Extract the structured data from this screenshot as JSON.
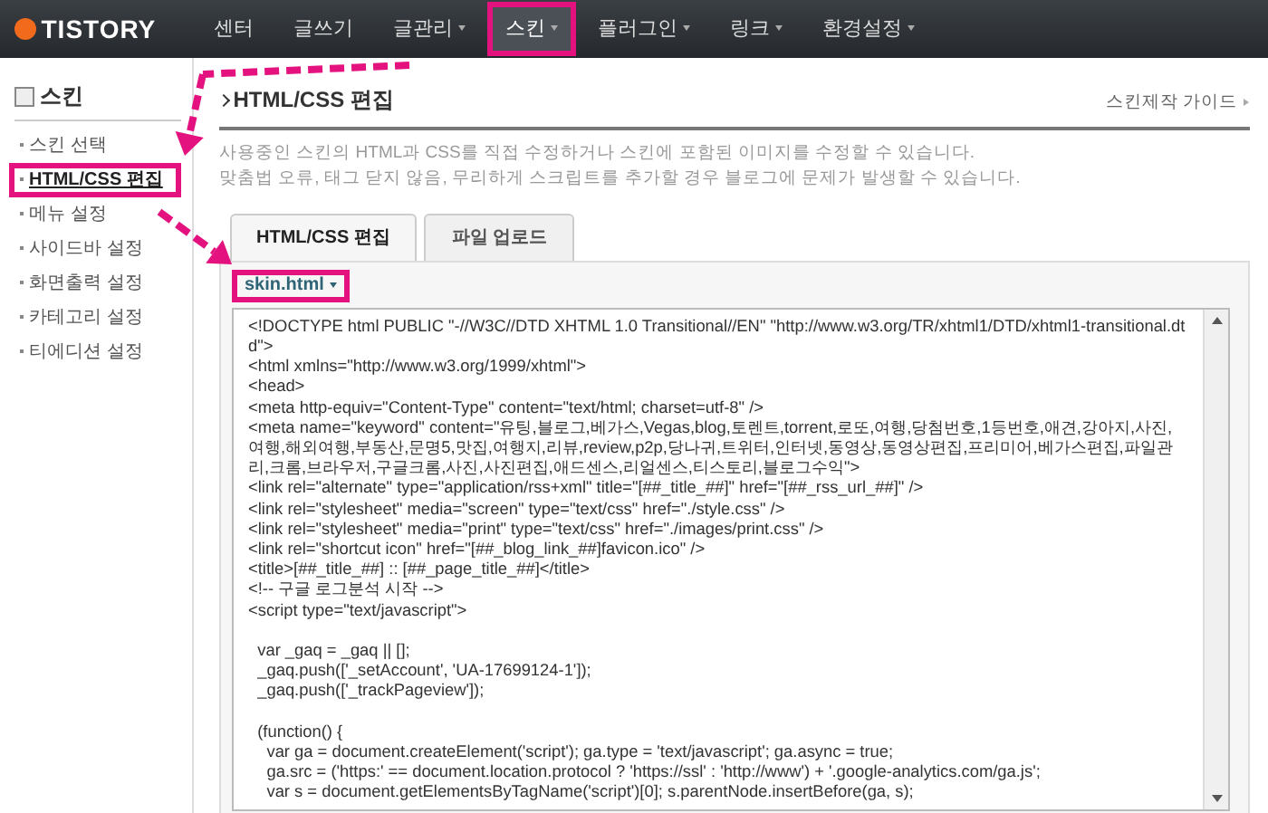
{
  "brand": {
    "name": "TISTORY"
  },
  "nav": [
    {
      "label": "센터",
      "has_menu": false,
      "selected": false,
      "highlighted": false
    },
    {
      "label": "글쓰기",
      "has_menu": false,
      "selected": false,
      "highlighted": false
    },
    {
      "label": "글관리",
      "has_menu": true,
      "selected": false,
      "highlighted": false
    },
    {
      "label": "스킨",
      "has_menu": true,
      "selected": true,
      "highlighted": true
    },
    {
      "label": "플러그인",
      "has_menu": true,
      "selected": false,
      "highlighted": false
    },
    {
      "label": "링크",
      "has_menu": true,
      "selected": false,
      "highlighted": false
    },
    {
      "label": "환경설정",
      "has_menu": true,
      "selected": false,
      "highlighted": false
    }
  ],
  "sidebar": {
    "title": "스킨",
    "items": [
      {
        "label": "스킨 선택",
        "selected": false,
        "highlighted": false
      },
      {
        "label": "HTML/CSS 편집",
        "selected": true,
        "highlighted": true
      },
      {
        "label": "메뉴 설정",
        "selected": false,
        "highlighted": false
      },
      {
        "label": "사이드바 설정",
        "selected": false,
        "highlighted": false
      },
      {
        "label": "화면출력 설정",
        "selected": false,
        "highlighted": false
      },
      {
        "label": "카테고리 설정",
        "selected": false,
        "highlighted": false
      },
      {
        "label": "티에디션 설정",
        "selected": false,
        "highlighted": false
      }
    ]
  },
  "page": {
    "title": "HTML/CSS 편집",
    "guide_link": "스킨제작 가이드",
    "description": [
      "사용중인 스킨의 HTML과 CSS를 직접 수정하거나 스킨에 포함된 이미지를 수정할 수 있습니다.",
      "맞춤법 오류, 태그 닫지 않음, 무리하게 스크립트를 추가할 경우 블로그에 문제가 발생할 수 있습니다."
    ]
  },
  "tabs": [
    {
      "label": "HTML/CSS 편집",
      "selected": true
    },
    {
      "label": "파일 업로드",
      "selected": false
    }
  ],
  "file_selector": {
    "value": "skin.html",
    "highlighted": true
  },
  "code_blocks": [
    [
      "<!DOCTYPE html PUBLIC \"-//W3C//DTD XHTML 1.0 Transitional//EN\" \"http://www.w3.org/TR/xhtml1/DTD/xhtml1-transitional.dtd\">",
      "<html xmlns=\"http://www.w3.org/1999/xhtml\">",
      "<head>",
      "<meta http-equiv=\"Content-Type\" content=\"text/html; charset=utf-8\" />",
      "<meta name=\"keyword\" content=\"유팅,블로그,베가스,Vegas,blog,토렌트,torrent,로또,여행,당첨번호,1등번호,애견,강아지,사진,여행,해외여행,부동산,문명5,맛집,여행지,리뷰,review,p2p,당나귀,트위터,인터넷,동영상,동영상편집,프리미어,베가스편집,파일관리,크롬,브라우저,구글크롬,사진,사진편집,애드센스,리얼센스,티스토리,블로그수익\">",
      "<link rel=\"alternate\" type=\"application/rss+xml\" title=\"[##_title_##]\" href=\"[##_rss_url_##]\" />",
      "<link rel=\"stylesheet\" media=\"screen\" type=\"text/css\" href=\"./style.css\" />",
      "<link rel=\"stylesheet\" media=\"print\" type=\"text/css\" href=\"./images/print.css\" />",
      "<link rel=\"shortcut icon\" href=\"[##_blog_link_##]favicon.ico\" />",
      "<title>[##_title_##] :: [##_page_title_##]</title>",
      "<!-- 구글 로그분석 시작 -->",
      "<script type=\"text/javascript\">"
    ],
    [
      "  var _gaq = _gaq || [];",
      "  _gaq.push(['_setAccount', 'UA-17699124-1']);",
      "  _gaq.push(['_trackPageview']);"
    ],
    [
      "  (function() {",
      "    var ga = document.createElement('script'); ga.type = 'text/javascript'; ga.async = true;",
      "    ga.src = ('https:' == document.location.protocol ? 'https://ssl' : 'http://www') + '.google-analytics.com/ga.js';",
      "    var s = document.getElementsByTagName('script')[0]; s.parentNode.insertBefore(ga, s);"
    ]
  ]
}
